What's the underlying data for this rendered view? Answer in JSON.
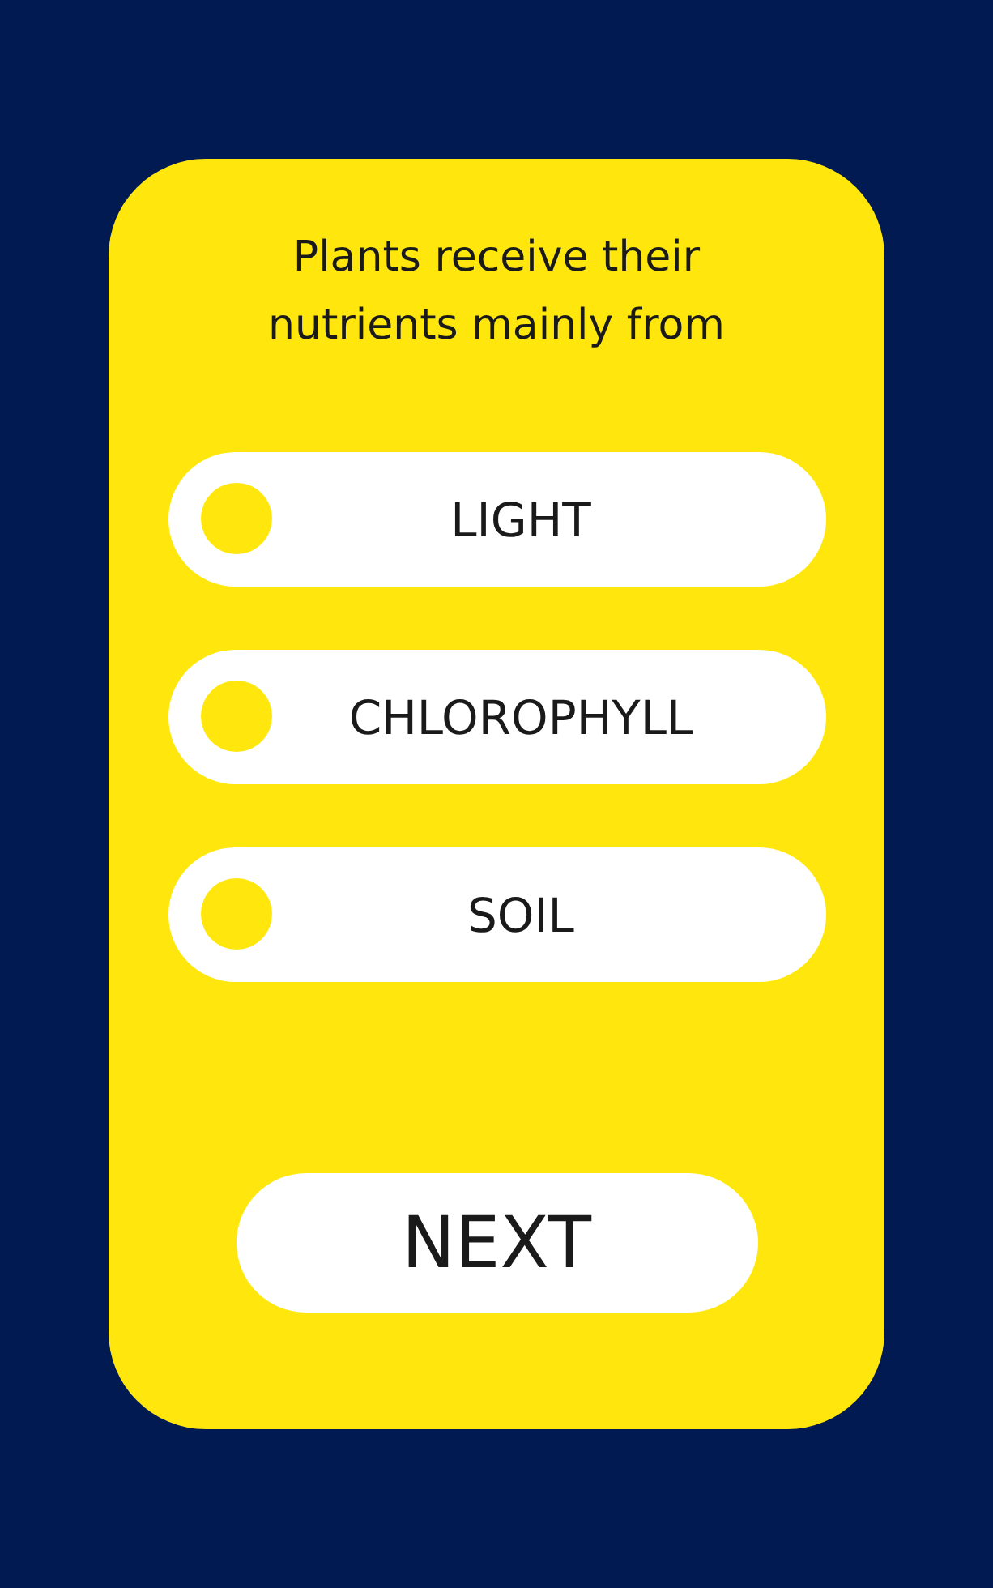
{
  "question": "Plants receive their nutrients mainly from",
  "options": [
    {
      "label": "LIGHT",
      "selected": false
    },
    {
      "label": "CHLOROPHYLL",
      "selected": false
    },
    {
      "label": "SOIL",
      "selected": false
    }
  ],
  "next_button": "NEXT"
}
